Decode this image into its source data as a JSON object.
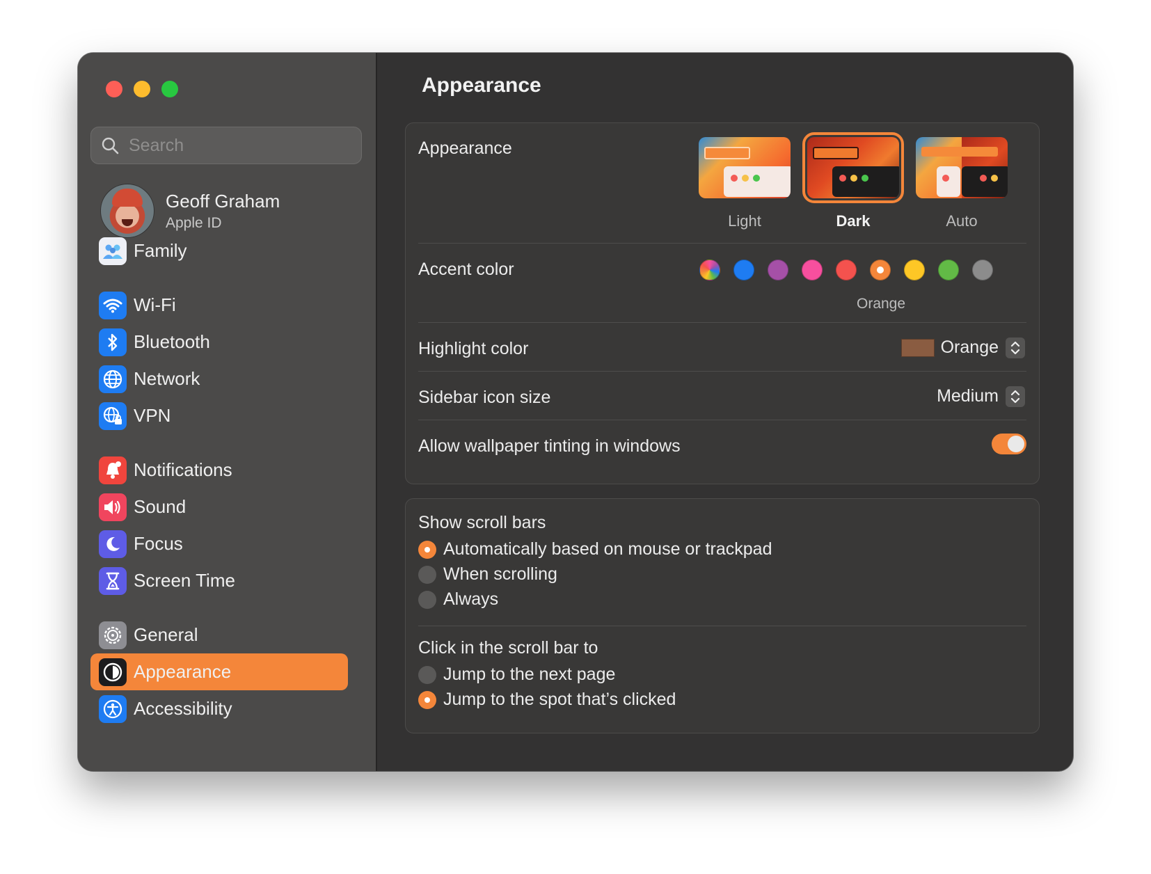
{
  "search": {
    "placeholder": "Search"
  },
  "profile": {
    "name": "Geoff Graham",
    "subtitle": "Apple ID"
  },
  "sidebar": {
    "items": [
      {
        "label": "Family",
        "icon": "family-icon",
        "color": "#e9e9ee"
      },
      {
        "label": "Wi-Fi",
        "icon": "wifi-icon",
        "color": "#1e7cf2"
      },
      {
        "label": "Bluetooth",
        "icon": "bluetooth-icon",
        "color": "#1e7cf2"
      },
      {
        "label": "Network",
        "icon": "globe-icon",
        "color": "#1e7cf2"
      },
      {
        "label": "VPN",
        "icon": "vpn-globe-icon",
        "color": "#1e7cf2"
      },
      {
        "label": "Notifications",
        "icon": "bell-icon",
        "color": "#f0453d"
      },
      {
        "label": "Sound",
        "icon": "speaker-icon",
        "color": "#f0455e"
      },
      {
        "label": "Focus",
        "icon": "moon-icon",
        "color": "#5e5ce6"
      },
      {
        "label": "Screen Time",
        "icon": "hourglass-icon",
        "color": "#5e5ce6"
      },
      {
        "label": "General",
        "icon": "gear-icon",
        "color": "#8e8e93"
      },
      {
        "label": "Appearance",
        "icon": "appearance-icon",
        "color": "#1c1c1e",
        "active": true
      },
      {
        "label": "Accessibility",
        "icon": "accessibility-icon",
        "color": "#1e7cf2"
      }
    ]
  },
  "main": {
    "title": "Appearance",
    "appearance": {
      "label": "Appearance",
      "options": [
        {
          "label": "Light",
          "selected": false
        },
        {
          "label": "Dark",
          "selected": true
        },
        {
          "label": "Auto",
          "selected": false
        }
      ]
    },
    "accent": {
      "label": "Accent color",
      "colors": [
        "multicolor",
        "#1e7cf2",
        "#a550a7",
        "#f74f9e",
        "#f4524e",
        "#f4863a",
        "#fec726",
        "#62ba46",
        "#8c8c8c"
      ],
      "selected_index": 5,
      "selected_name": "Orange"
    },
    "highlight": {
      "label": "Highlight color",
      "value": "Orange",
      "swatch": "#8a5c41"
    },
    "sidebar_icon_size": {
      "label": "Sidebar icon size",
      "value": "Medium"
    },
    "wallpaper_tinting": {
      "label": "Allow wallpaper tinting in windows",
      "on": true
    },
    "scroll_bars": {
      "label": "Show scroll bars",
      "options": [
        {
          "label": "Automatically based on mouse or trackpad",
          "selected": true
        },
        {
          "label": "When scrolling",
          "selected": false
        },
        {
          "label": "Always",
          "selected": false
        }
      ]
    },
    "click_scroll": {
      "label": "Click in the scroll bar to",
      "options": [
        {
          "label": "Jump to the next page",
          "selected": false
        },
        {
          "label": "Jump to the spot that’s clicked",
          "selected": true
        }
      ]
    }
  },
  "colors": {
    "accent": "#f4863a",
    "sidebar_bg": "#4b4a49",
    "main_bg": "#333232"
  }
}
